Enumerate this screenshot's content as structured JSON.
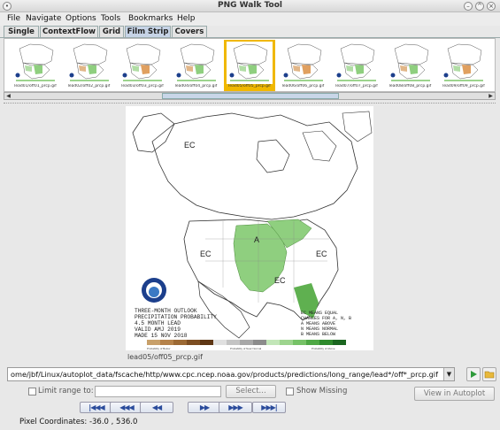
{
  "window": {
    "title": "PNG Walk Tool"
  },
  "menu": [
    "File",
    "Navigate",
    "Options",
    "Tools",
    "Bookmarks",
    "Help"
  ],
  "tabs": [
    {
      "label": "Single",
      "active": false
    },
    {
      "label": "ContextFlow",
      "active": false
    },
    {
      "label": "Grid",
      "active": false
    },
    {
      "label": "Film Strip",
      "active": true
    },
    {
      "label": "Covers",
      "active": false
    }
  ],
  "thumbnails": [
    {
      "caption": "lead01/off01_prcp.gif",
      "selected": false
    },
    {
      "caption": "lead02/off02_prcp.gif",
      "selected": false
    },
    {
      "caption": "lead03/off03_prcp.gif",
      "selected": false
    },
    {
      "caption": "lead04/off04_prcp.gif",
      "selected": false
    },
    {
      "caption": "lead05/off05_prcp.gif",
      "selected": true
    },
    {
      "caption": "lead06/off06_prcp.gif",
      "selected": false
    },
    {
      "caption": "lead07/off07_prcp.gif",
      "selected": false
    },
    {
      "caption": "lead08/off08_prcp.gif",
      "selected": false
    },
    {
      "caption": "lead09/off09_prcp.gif",
      "selected": false
    }
  ],
  "strip_scroll": {
    "left_arrow": "◀",
    "right_arrow": "▶"
  },
  "main_image": {
    "caption": "lead05/off05_prcp.gif",
    "map_labels": [
      "EC",
      "EC",
      "A",
      "EC",
      "EC"
    ],
    "title_lines": [
      "THREE-MONTH OUTLOOK",
      "PRECIPITATION PROBABILITY",
      "4.5 MONTH LEAD",
      "VALID AMJ 2019",
      "MADE 15 NOV 2018"
    ],
    "key_lines": [
      "EC MEANS EQUAL",
      "CHANCES FOR A, N, B",
      "A MEANS ABOVE",
      "N MEANS NORMAL",
      "B MEANS BELOW"
    ],
    "legend_labels": [
      "Probability of Below",
      "Probability of Near Normal",
      "Probability of Above"
    ],
    "legend_colors": [
      "#c8a06a",
      "#b5824a",
      "#9c6934",
      "#7d4e22",
      "#5e3614",
      "#e0e0e0",
      "#c4c4c4",
      "#a8a8a8",
      "#8c8c8c",
      "#c2e6b8",
      "#9dd48e",
      "#76c267",
      "#4fa845",
      "#2e8a2c",
      "#1b6620"
    ]
  },
  "path": {
    "value": "ome/jbf/Linux/autoplot_data/fscache/http/www.cpc.ncep.noaa.gov/products/predictions/long_range/lead*/off*_prcp.gif",
    "dropdown_icon": "▼"
  },
  "controls": {
    "limit_range_label": "Limit range to:",
    "select_label": "Select...",
    "show_missing_label": "Show Missing",
    "view_in_autoplot_label": "View in Autoplot"
  },
  "nav_buttons": [
    {
      "name": "first",
      "label": "|◀◀◀"
    },
    {
      "name": "page-back",
      "label": "◀◀◀"
    },
    {
      "name": "prev",
      "label": "◀◀"
    },
    {
      "name": "next",
      "label": "▶▶"
    },
    {
      "name": "page-forward",
      "label": "▶▶▶"
    },
    {
      "name": "last",
      "label": "▶▶▶|"
    }
  ],
  "status": {
    "pixel_coords": "Pixel Coordinates: -36.0 , 536.0"
  }
}
